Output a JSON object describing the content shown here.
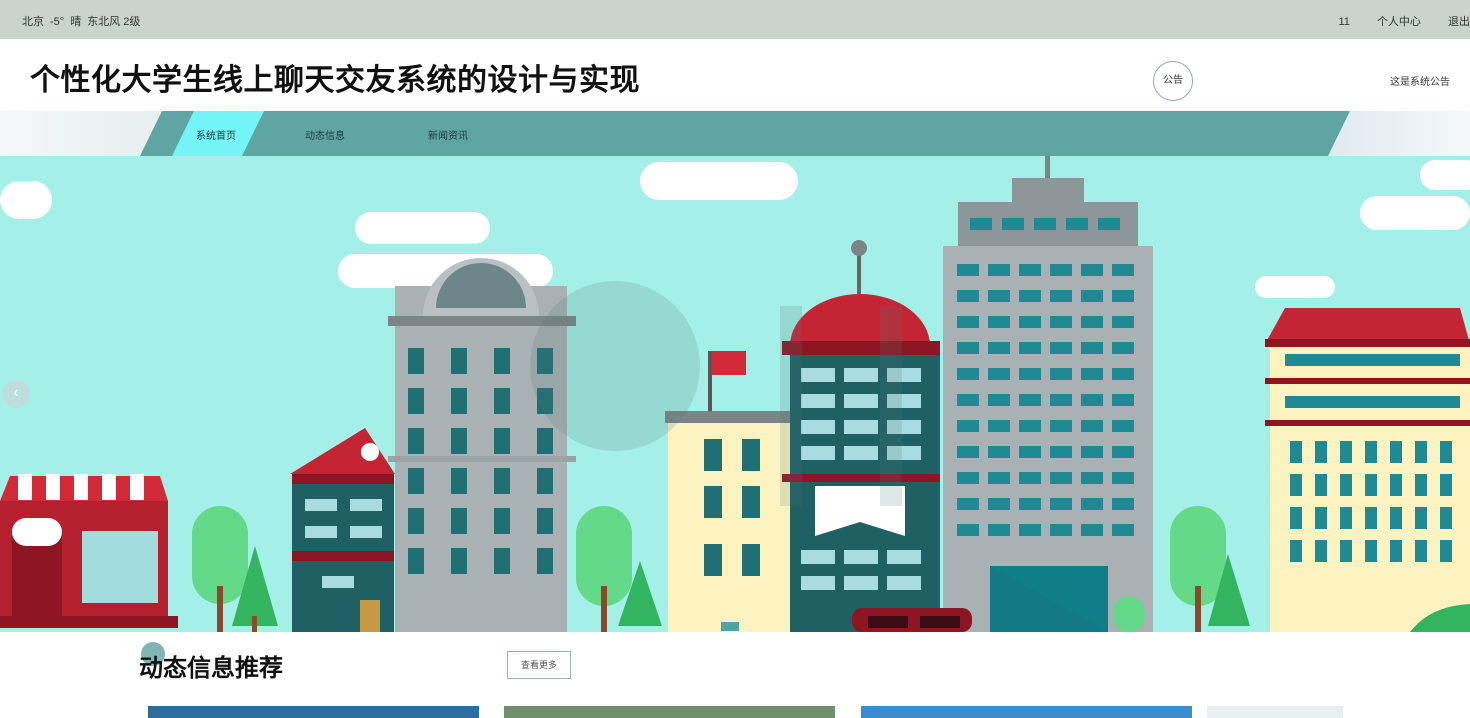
{
  "topbar": {
    "weather": {
      "city": "北京",
      "temperature": "-5°",
      "condition": "晴",
      "wind": "东北风 2级"
    },
    "user_count": "11",
    "personal_center": "个人中心",
    "logout": "退出"
  },
  "header": {
    "title": "个性化大学生线上聊天交友系统的设计与实现",
    "notice_label": "公告",
    "notice_text": "这是系统公告"
  },
  "nav": {
    "items": [
      {
        "label": "系统首页",
        "active": true
      },
      {
        "label": "动态信息",
        "active": false
      },
      {
        "label": "新闻资讯",
        "active": false
      }
    ]
  },
  "banner": {
    "prev_icon": "chevron-left-icon"
  },
  "section": {
    "title": "动态信息推荐",
    "more_label": "查看更多"
  },
  "colors": {
    "topbar_bg": "#c8d4cd",
    "nav_band": "#5fa5a3",
    "nav_active": "#75f4f7",
    "sky": "#a4efe7",
    "accent": "#4aa5a3"
  }
}
